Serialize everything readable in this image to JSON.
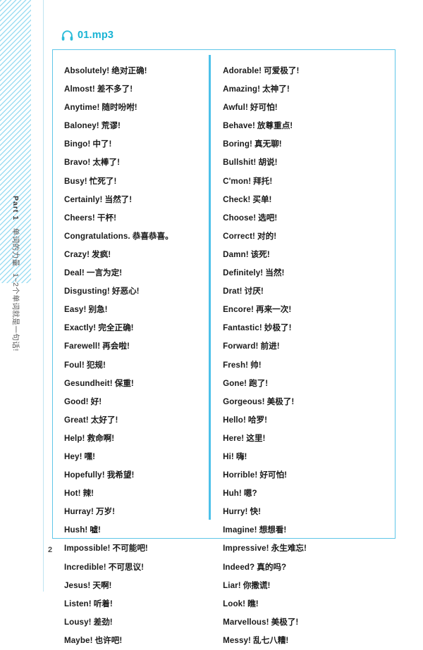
{
  "page": {
    "folio": "2",
    "accent_color": "#4cc1ea",
    "audio_color": "#17b3d4",
    "box_border_color": "#5fc6e8",
    "stripe_color": "#8ed8f0"
  },
  "running_head": {
    "part_label": "Part 1",
    "title_cn": "单词的力量",
    "subtitle_cn": "1~2个单词就是一句话!"
  },
  "audio": {
    "icon": "headphones-icon",
    "track": "01.mp3"
  },
  "phrases": {
    "left_column": [
      {
        "en": "Absolutely!",
        "cn": "绝对正确!"
      },
      {
        "en": "Almost!",
        "cn": "差不多了!"
      },
      {
        "en": "Anytime!",
        "cn": "随时吩咐!"
      },
      {
        "en": "Baloney!",
        "cn": "荒谬!"
      },
      {
        "en": "Bingo!",
        "cn": "中了!"
      },
      {
        "en": "Bravo!",
        "cn": "太棒了!"
      },
      {
        "en": "Busy!",
        "cn": "忙死了!"
      },
      {
        "en": "Certainly!",
        "cn": "当然了!"
      },
      {
        "en": "Cheers!",
        "cn": "干杯!"
      },
      {
        "en": "Congratulations.",
        "cn": "恭喜恭喜。"
      },
      {
        "en": "Crazy!",
        "cn": "发疯!"
      },
      {
        "en": "Deal!",
        "cn": "一言为定!"
      },
      {
        "en": "Disgusting!",
        "cn": "好恶心!"
      },
      {
        "en": "Easy!",
        "cn": "别急!"
      },
      {
        "en": "Exactly!",
        "cn": "完全正确!"
      },
      {
        "en": "Farewell!",
        "cn": "再会啦!"
      },
      {
        "en": "Foul!",
        "cn": "犯规!"
      },
      {
        "en": "Gesundheit!",
        "cn": "保重!"
      },
      {
        "en": "Good!",
        "cn": "好!"
      },
      {
        "en": "Great!",
        "cn": "太好了!"
      },
      {
        "en": "Help!",
        "cn": "救命啊!"
      },
      {
        "en": "Hey!",
        "cn": "嘿!"
      },
      {
        "en": "Hopefully!",
        "cn": "我希望!"
      },
      {
        "en": "Hot!",
        "cn": "辣!"
      },
      {
        "en": "Hurray!",
        "cn": "万岁!"
      },
      {
        "en": "Hush!",
        "cn": "嘘!"
      },
      {
        "en": "Impossible!",
        "cn": "不可能吧!"
      },
      {
        "en": "Incredible!",
        "cn": "不可思议!"
      },
      {
        "en": "Jesus!",
        "cn": "天啊!"
      },
      {
        "en": "Listen!",
        "cn": "听着!"
      },
      {
        "en": "Lousy!",
        "cn": "差劲!"
      },
      {
        "en": "Maybe!",
        "cn": "也许吧!"
      }
    ],
    "right_column": [
      {
        "en": "Adorable!",
        "cn": "可爱极了!"
      },
      {
        "en": "Amazing!",
        "cn": "太神了!"
      },
      {
        "en": "Awful!",
        "cn": "好可怕!"
      },
      {
        "en": "Behave!",
        "cn": "放尊重点!"
      },
      {
        "en": "Boring!",
        "cn": "真无聊!"
      },
      {
        "en": "Bullshit!",
        "cn": "胡说!"
      },
      {
        "en": "C'mon!",
        "cn": "拜托!"
      },
      {
        "en": "Check!",
        "cn": "买单!"
      },
      {
        "en": "Choose!",
        "cn": "选吧!"
      },
      {
        "en": "Correct!",
        "cn": "对的!"
      },
      {
        "en": "Damn!",
        "cn": "该死!"
      },
      {
        "en": "Definitely!",
        "cn": "当然!"
      },
      {
        "en": "Drat!",
        "cn": "讨厌!"
      },
      {
        "en": "Encore!",
        "cn": "再来一次!"
      },
      {
        "en": "Fantastic!",
        "cn": "妙极了!"
      },
      {
        "en": "Forward!",
        "cn": "前进!"
      },
      {
        "en": "Fresh!",
        "cn": "帅!"
      },
      {
        "en": "Gone!",
        "cn": "跑了!"
      },
      {
        "en": "Gorgeous!",
        "cn": "美极了!"
      },
      {
        "en": "Hello!",
        "cn": "哈罗!"
      },
      {
        "en": "Here!",
        "cn": "这里!"
      },
      {
        "en": "Hi!",
        "cn": "嗨!"
      },
      {
        "en": "Horrible!",
        "cn": "好可怕!"
      },
      {
        "en": "Huh!",
        "cn": "嗯?"
      },
      {
        "en": "Hurry!",
        "cn": "快!"
      },
      {
        "en": "Imagine!",
        "cn": "想想看!"
      },
      {
        "en": "Impressive!",
        "cn": "永生难忘!"
      },
      {
        "en": "Indeed?",
        "cn": "真的吗?"
      },
      {
        "en": "Liar!",
        "cn": "你撒谎!"
      },
      {
        "en": "Look!",
        "cn": "瞧!"
      },
      {
        "en": "Marvellous!",
        "cn": "美极了!"
      },
      {
        "en": "Messy!",
        "cn": "乱七八糟!"
      }
    ]
  }
}
